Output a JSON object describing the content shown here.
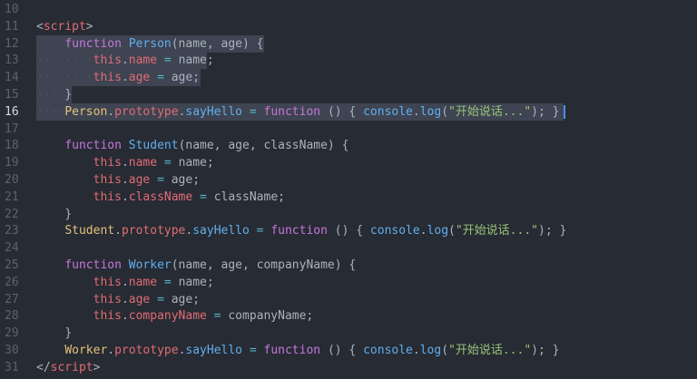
{
  "editor": {
    "background": "#272b33",
    "active_line": "16",
    "lines": [
      {
        "n": "10",
        "indent": "",
        "tokens": []
      },
      {
        "n": "11",
        "indent": "",
        "tokens": [
          {
            "t": "<",
            "c": "pl"
          },
          {
            "t": "script",
            "c": "tag"
          },
          {
            "t": ">",
            "c": "pl"
          }
        ]
      },
      {
        "n": "12",
        "indent": "    ",
        "tokens": [
          {
            "t": "function",
            "c": "kw"
          },
          {
            "t": " ",
            "c": "pl"
          },
          {
            "t": "Person",
            "c": "fn"
          },
          {
            "t": "(name, age) {",
            "c": "pl"
          }
        ]
      },
      {
        "n": "13",
        "indent": "········",
        "tokens": [
          {
            "t": "this",
            "c": "this"
          },
          {
            "t": ".",
            "c": "pl"
          },
          {
            "t": "name",
            "c": "prop"
          },
          {
            "t": " = ",
            "c": "op"
          },
          {
            "t": "name;",
            "c": "pl"
          }
        ]
      },
      {
        "n": "14",
        "indent": "········",
        "tokens": [
          {
            "t": "this",
            "c": "this"
          },
          {
            "t": ".",
            "c": "pl"
          },
          {
            "t": "age",
            "c": "prop"
          },
          {
            "t": " = ",
            "c": "op"
          },
          {
            "t": "age;",
            "c": "pl"
          }
        ]
      },
      {
        "n": "15",
        "indent": "····",
        "tokens": [
          {
            "t": "}",
            "c": "pl"
          }
        ]
      },
      {
        "n": "16",
        "indent": "····",
        "tokens": [
          {
            "t": "Person",
            "c": "cls"
          },
          {
            "t": ".",
            "c": "pl"
          },
          {
            "t": "prototype",
            "c": "prop"
          },
          {
            "t": ".",
            "c": "pl"
          },
          {
            "t": "sayHello",
            "c": "fn"
          },
          {
            "t": " = ",
            "c": "op"
          },
          {
            "t": "function",
            "c": "kw"
          },
          {
            "t": " () { ",
            "c": "pl"
          },
          {
            "t": "console",
            "c": "fn"
          },
          {
            "t": ".",
            "c": "pl"
          },
          {
            "t": "log",
            "c": "fn"
          },
          {
            "t": "(",
            "c": "pl"
          },
          {
            "t": "\"开始说话...\"",
            "c": "str"
          },
          {
            "t": "); }",
            "c": "pl"
          }
        ]
      },
      {
        "n": "17",
        "indent": "",
        "tokens": []
      },
      {
        "n": "18",
        "indent": "    ",
        "tokens": [
          {
            "t": "function",
            "c": "kw"
          },
          {
            "t": " ",
            "c": "pl"
          },
          {
            "t": "Student",
            "c": "fn"
          },
          {
            "t": "(name, age, className) {",
            "c": "pl"
          }
        ]
      },
      {
        "n": "19",
        "indent": "        ",
        "tokens": [
          {
            "t": "this",
            "c": "this"
          },
          {
            "t": ".",
            "c": "pl"
          },
          {
            "t": "name",
            "c": "prop"
          },
          {
            "t": " = ",
            "c": "op"
          },
          {
            "t": "name;",
            "c": "pl"
          }
        ]
      },
      {
        "n": "20",
        "indent": "        ",
        "tokens": [
          {
            "t": "this",
            "c": "this"
          },
          {
            "t": ".",
            "c": "pl"
          },
          {
            "t": "age",
            "c": "prop"
          },
          {
            "t": " = ",
            "c": "op"
          },
          {
            "t": "age;",
            "c": "pl"
          }
        ]
      },
      {
        "n": "21",
        "indent": "        ",
        "tokens": [
          {
            "t": "this",
            "c": "this"
          },
          {
            "t": ".",
            "c": "pl"
          },
          {
            "t": "className",
            "c": "prop"
          },
          {
            "t": " = ",
            "c": "op"
          },
          {
            "t": "className;",
            "c": "pl"
          }
        ]
      },
      {
        "n": "22",
        "indent": "    ",
        "tokens": [
          {
            "t": "}",
            "c": "pl"
          }
        ]
      },
      {
        "n": "23",
        "indent": "    ",
        "tokens": [
          {
            "t": "Student",
            "c": "cls"
          },
          {
            "t": ".",
            "c": "pl"
          },
          {
            "t": "prototype",
            "c": "prop"
          },
          {
            "t": ".",
            "c": "pl"
          },
          {
            "t": "sayHello",
            "c": "fn"
          },
          {
            "t": " = ",
            "c": "op"
          },
          {
            "t": "function",
            "c": "kw"
          },
          {
            "t": " () { ",
            "c": "pl"
          },
          {
            "t": "console",
            "c": "fn"
          },
          {
            "t": ".",
            "c": "pl"
          },
          {
            "t": "log",
            "c": "fn"
          },
          {
            "t": "(",
            "c": "pl"
          },
          {
            "t": "\"开始说话...\"",
            "c": "str"
          },
          {
            "t": "); }",
            "c": "pl"
          }
        ]
      },
      {
        "n": "24",
        "indent": "",
        "tokens": []
      },
      {
        "n": "25",
        "indent": "    ",
        "tokens": [
          {
            "t": "function",
            "c": "kw"
          },
          {
            "t": " ",
            "c": "pl"
          },
          {
            "t": "Worker",
            "c": "fn"
          },
          {
            "t": "(name, age, companyName) {",
            "c": "pl"
          }
        ]
      },
      {
        "n": "26",
        "indent": "        ",
        "tokens": [
          {
            "t": "this",
            "c": "this"
          },
          {
            "t": ".",
            "c": "pl"
          },
          {
            "t": "name",
            "c": "prop"
          },
          {
            "t": " = ",
            "c": "op"
          },
          {
            "t": "name;",
            "c": "pl"
          }
        ]
      },
      {
        "n": "27",
        "indent": "        ",
        "tokens": [
          {
            "t": "this",
            "c": "this"
          },
          {
            "t": ".",
            "c": "pl"
          },
          {
            "t": "age",
            "c": "prop"
          },
          {
            "t": " = ",
            "c": "op"
          },
          {
            "t": "age;",
            "c": "pl"
          }
        ]
      },
      {
        "n": "28",
        "indent": "        ",
        "tokens": [
          {
            "t": "this",
            "c": "this"
          },
          {
            "t": ".",
            "c": "pl"
          },
          {
            "t": "companyName",
            "c": "prop"
          },
          {
            "t": " = ",
            "c": "op"
          },
          {
            "t": "companyName;",
            "c": "pl"
          }
        ]
      },
      {
        "n": "29",
        "indent": "    ",
        "tokens": [
          {
            "t": "}",
            "c": "pl"
          }
        ]
      },
      {
        "n": "30",
        "indent": "    ",
        "tokens": [
          {
            "t": "Worker",
            "c": "cls"
          },
          {
            "t": ".",
            "c": "pl"
          },
          {
            "t": "prototype",
            "c": "prop"
          },
          {
            "t": ".",
            "c": "pl"
          },
          {
            "t": "sayHello",
            "c": "fn"
          },
          {
            "t": " = ",
            "c": "op"
          },
          {
            "t": "function",
            "c": "kw"
          },
          {
            "t": " () { ",
            "c": "pl"
          },
          {
            "t": "console",
            "c": "fn"
          },
          {
            "t": ".",
            "c": "pl"
          },
          {
            "t": "log",
            "c": "fn"
          },
          {
            "t": "(",
            "c": "pl"
          },
          {
            "t": "\"开始说话...\"",
            "c": "str"
          },
          {
            "t": "); }",
            "c": "pl"
          }
        ]
      },
      {
        "n": "31",
        "indent": "",
        "tokens": [
          {
            "t": "</",
            "c": "pl"
          },
          {
            "t": "script",
            "c": "tag"
          },
          {
            "t": ">",
            "c": "pl"
          }
        ]
      }
    ]
  }
}
